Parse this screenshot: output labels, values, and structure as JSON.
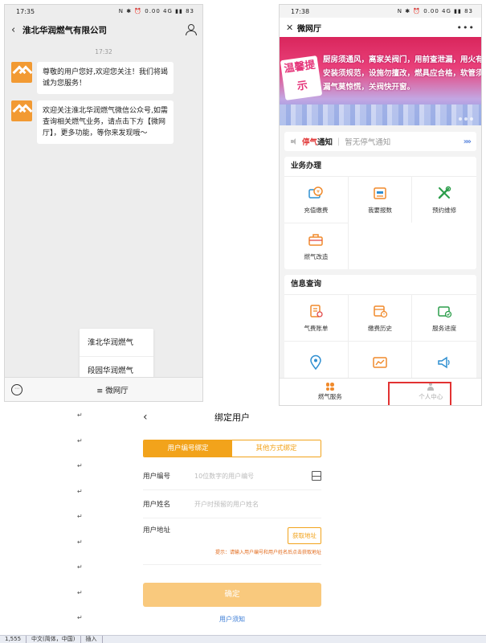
{
  "left_phone": {
    "status_time": "17:35",
    "status_icons": "N ✱ ⏰ 0.00 4G ▮▮ 83",
    "header_title": "淮北华润燃气有限公司",
    "chat_time": "17:32",
    "messages": [
      "尊敬的用户您好,欢迎您关注！我们将竭诚为您服务！",
      "欢迎关注淮北华润燃气微信公众号,如需查询相关燃气业务，请点击下方【微网厅】，更多功能，等你来发现哦～"
    ],
    "menu_popup": [
      "淮北华润燃气",
      "段园华润燃气"
    ],
    "bottom_menu": "≡ 微网厅"
  },
  "right_phone": {
    "status_time": "17:38",
    "status_icons": "N ✱ ⏰ 0.00 4G ▮▮ 83",
    "header_title": "微网厅",
    "more": "•••",
    "banner": {
      "promo": "温馨提示",
      "lines": [
        "厨房须通风，离家关阀门，用前查泄漏，用火有人守。",
        "安装须规范，设施勿擅改，燃具应合格，软管须可靠。",
        "漏气莫惊慌，关阀快开窗。"
      ]
    },
    "notice": {
      "red": "停气",
      "black": "通知",
      "sep": "|",
      "text": "暂无停气通知",
      "arrows": "»»"
    },
    "business": {
      "title": "业务办理",
      "items": [
        "充值缴费",
        "我要报数",
        "预约维修",
        "燃气改造"
      ]
    },
    "info": {
      "title": "信息查询",
      "items": [
        "气费账单",
        "缴费历史",
        "服务进度",
        "",
        "",
        ""
      ]
    },
    "tabs": [
      "燃气服务",
      "个人中心"
    ]
  },
  "form": {
    "title": "绑定用户",
    "seg_on": "用户编号绑定",
    "seg_off": "其他方式绑定",
    "user_no_label": "用户编号",
    "user_no_placeholder": "10位数字的用户编号",
    "user_name_label": "用户姓名",
    "user_name_placeholder": "开户时预留的用户姓名",
    "address_label": "用户地址",
    "get_address": "获取地址",
    "hint": "提示：请输入用户编号和用户姓名后点击获取地址",
    "confirm": "确定",
    "notice_link": "用户须知"
  },
  "return_mark": "↵",
  "editor_bar": [
    "1,555",
    "中文(简体，中国)",
    "插入"
  ],
  "colors": {
    "accent_orange": "#f2a31b",
    "highlight_red": "#e23232",
    "link_blue": "#3b7cd6"
  }
}
